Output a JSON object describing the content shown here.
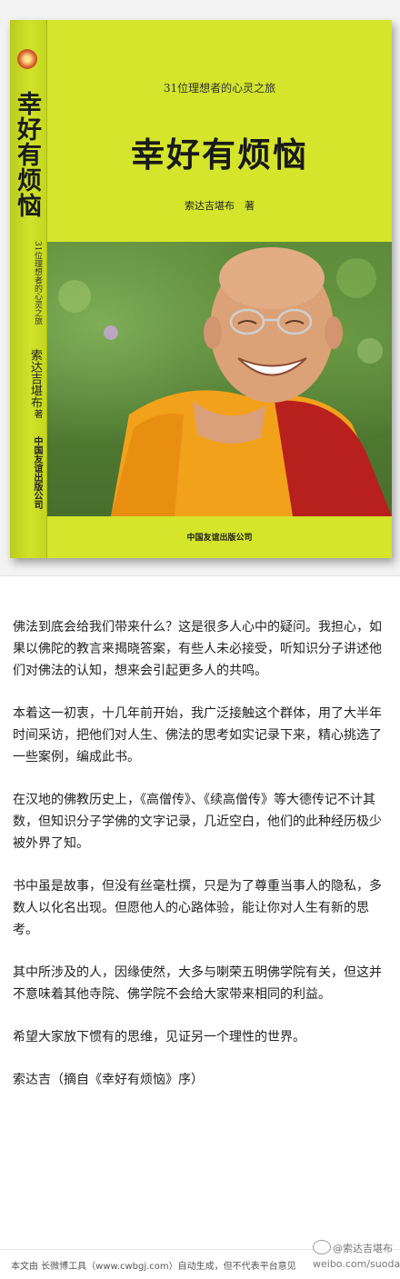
{
  "book": {
    "spine_title": "幸好有烦恼",
    "spine_subtitle": "31位理想者的心灵之旅",
    "spine_author": "索达吉堪布",
    "spine_zhu": "著",
    "spine_publisher": "中国友谊出版公司",
    "front_subtitle": "31位理想者的心灵之旅",
    "front_title": "幸好有烦恼",
    "front_author": "索达吉堪布　著",
    "front_publisher": "中国友谊出版公司",
    "cover_color": "#d4e52c"
  },
  "article": {
    "paragraphs": [
      "佛法到底会给我们带来什么？这是很多人心中的疑问。我担心，如果以佛陀的教言来揭晓答案，有些人未必接受，听知识分子讲述他们对佛法的认知，想来会引起更多人的共鸣。",
      "本着这一初衷，十几年前开始，我广泛接触这个群体，用了大半年时间采访，把他们对人生、佛法的思考如实记录下来，精心挑选了一些案例，编成此书。",
      "在汉地的佛教历史上，《高僧传》、《续高僧传》等大德传记不计其数，但知识分子学佛的文字记录，几近空白，他们的此种经历极少被外界了知。",
      "书中虽是故事，但没有丝毫杜撰，只是为了尊重当事人的隐私，多数人以化名出现。但愿他人的心路体验，能让你对人生有新的思考。",
      "其中所涉及的人，因缘使然，大多与喇荣五明佛学院有关，但这并不意味着其他寺院、佛学院不会给大家带来相同的利益。",
      "希望大家放下惯有的思维，见证另一个理性的世界。",
      "索达吉（摘自《幸好有烦恼》序）"
    ]
  },
  "footer": {
    "note": "本文由 长微博工具（www.cwbgj.com）自动生成，但不代表平台意见",
    "watermark_handle": "@索达吉堪布",
    "watermark_url": "weibo.com/suodaji"
  }
}
